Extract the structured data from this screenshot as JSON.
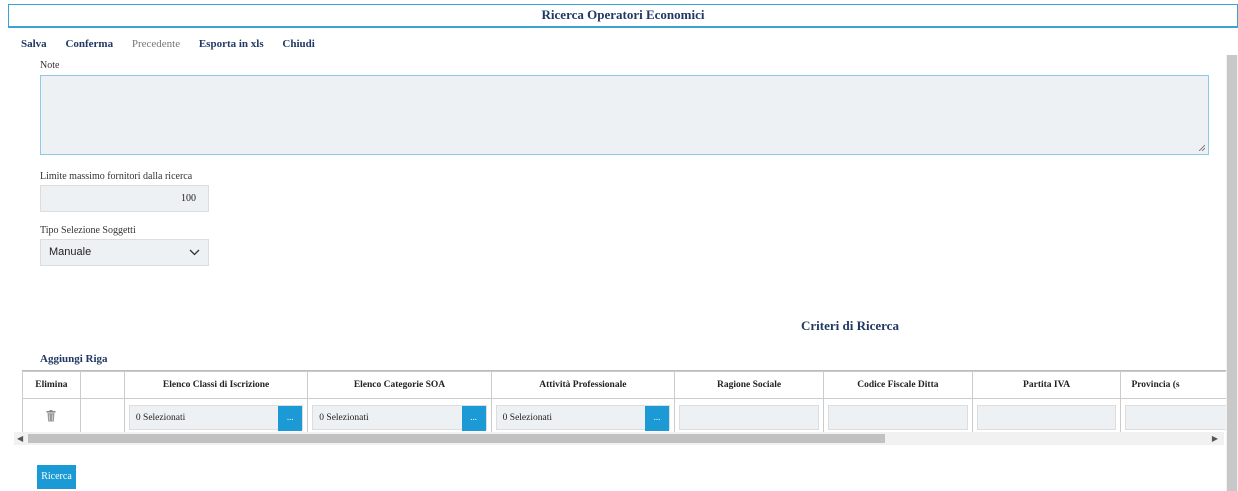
{
  "window": {
    "title": "Ricerca Operatori Economici"
  },
  "toolbar": {
    "salva": "Salva",
    "conferma": "Conferma",
    "precedente": "Precedente",
    "esporta": "Esporta in xls",
    "chiudi": "Chiudi"
  },
  "form": {
    "note_label": "Note",
    "note_value": "",
    "limit_label": "Limite massimo fornitori dalla ricerca",
    "limit_value": "100",
    "tipo_label": "Tipo Selezione Soggetti",
    "tipo_value": "Manuale"
  },
  "criteria": {
    "title": "Criteri di Ricerca",
    "add_row": "Aggiungi Riga",
    "columns": [
      "Elimina",
      "",
      "Elenco Classi di Iscrizione",
      "Elenco Categorie SOA",
      "Attività Professionale",
      "Ragione Sociale",
      "Codice Fiscale Ditta",
      "Partita IVA",
      "Provincia (s"
    ],
    "row": {
      "classi": "0 Selezionati",
      "soa": "0 Selezionati",
      "attivita": "0 Selezionati",
      "button_label": "..."
    }
  },
  "search_button": "Ricerca",
  "icons": {
    "delete": "trash-icon",
    "dropdown": "chevron-down-icon"
  },
  "colors": {
    "accent": "#1b9ad6",
    "title": "#1f3864"
  }
}
